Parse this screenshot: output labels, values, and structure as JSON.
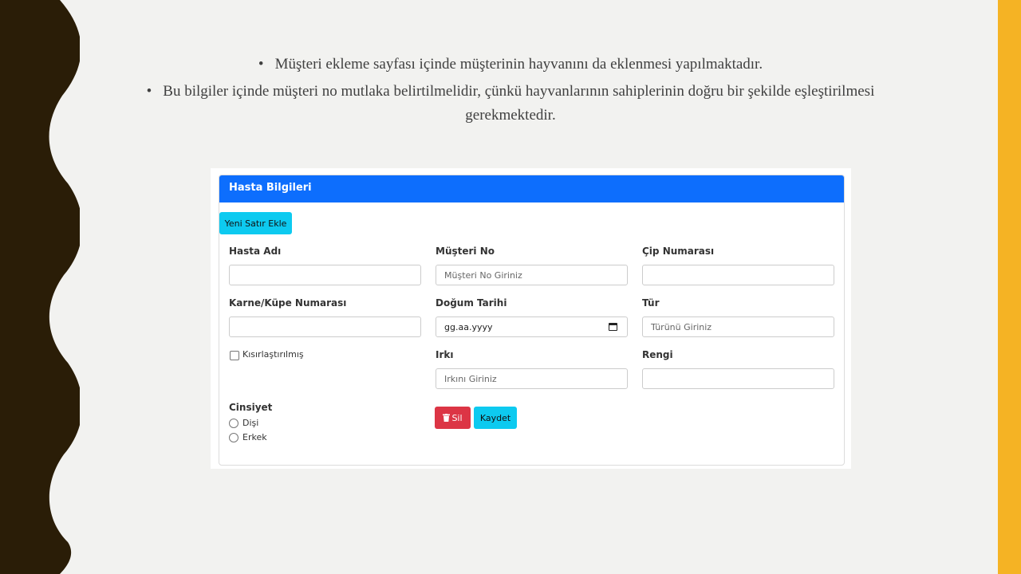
{
  "colors": {
    "left_wave": "#2a1d07",
    "right_bar": "#f5b324",
    "header": "#0d6efd",
    "add_button": "#0dcaf0",
    "delete_button": "#dc3545",
    "save_button": "#0dcaf0"
  },
  "bullets": [
    "Müşteri ekleme sayfası içinde müşterinin hayvanını da eklenmesi yapılmaktadır.",
    "Bu bilgiler içinde müşteri no mutlaka belirtilmelidir, çünkü hayvanlarının sahiplerinin doğru bir şekilde eşleştirilmesi gerekmektedir."
  ],
  "form": {
    "header": "Hasta Bilgileri",
    "add_row_button": "Yeni Satır Ekle",
    "fields": {
      "hasta_adi": {
        "label": "Hasta Adı",
        "value": "",
        "placeholder": ""
      },
      "musteri_no": {
        "label": "Müşteri No",
        "value": "",
        "placeholder": "Müşteri No Giriniz"
      },
      "cip_numarasi": {
        "label": "Çip Numarası",
        "value": "",
        "placeholder": ""
      },
      "karne_kupe": {
        "label": "Karne/Küpe Numarası",
        "value": "",
        "placeholder": ""
      },
      "dogum_tarihi": {
        "label": "Doğum Tarihi",
        "value": "gg.aa.yyyy",
        "placeholder": ""
      },
      "tur": {
        "label": "Tür",
        "value": "",
        "placeholder": "Türünü Giriniz"
      },
      "irki": {
        "label": "Irkı",
        "value": "",
        "placeholder": "Irkını Giriniz"
      },
      "rengi": {
        "label": "Rengi",
        "value": "",
        "placeholder": ""
      }
    },
    "kisirlastirilmis": {
      "label": "Kısırlaştırılmış",
      "checked": false
    },
    "cinsiyet": {
      "label": "Cinsiyet",
      "options": [
        "Dişi",
        "Erkek"
      ],
      "selected": null
    },
    "delete_button": {
      "label": "Sil",
      "icon": "trash-icon"
    },
    "save_button": "Kaydet"
  }
}
